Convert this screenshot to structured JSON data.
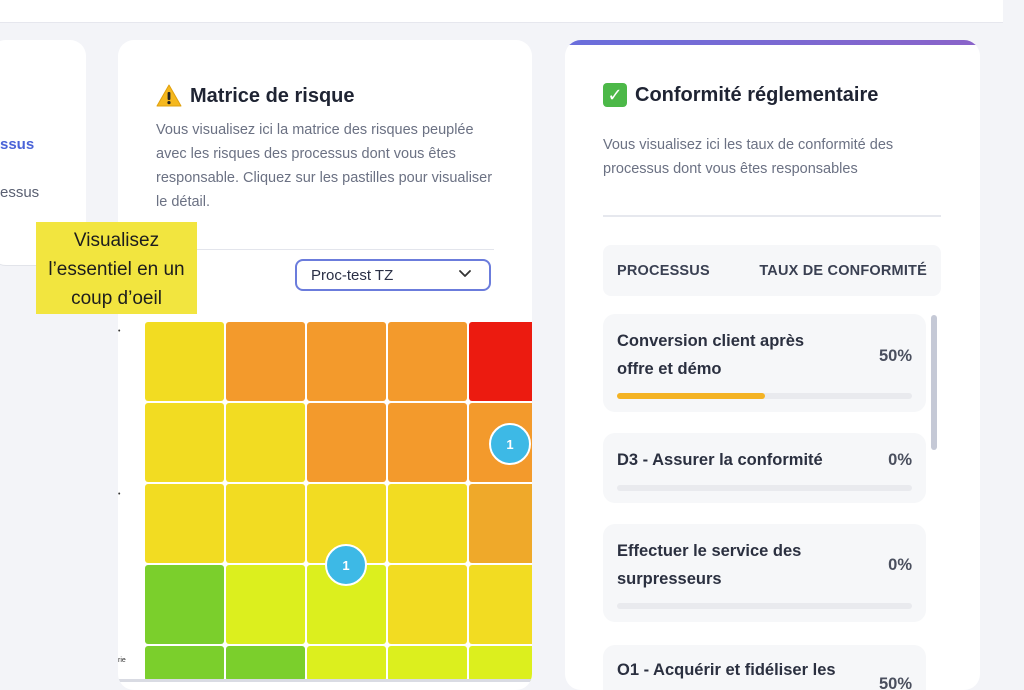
{
  "left_panel": {
    "item_active": "ssus",
    "item": "essus"
  },
  "matrix_card": {
    "title": "Matrice de risque",
    "description": "Vous visualisez ici la matrice des risques peuplée avec les risques des processus dont vous êtes responsable. Cliquez sur les pastilles pour visualiser le détail.",
    "select_value": "Proc-test TZ",
    "dot_labels": [
      "1",
      "1"
    ],
    "bottom_tick": "rie",
    "colors": {
      "red": "#ec1b10",
      "orange": "#f39a2c",
      "yellow_orange": "#efa92a",
      "yellow": "#f2dc22",
      "lime": "#dcef1e",
      "green": "#7bcf2c"
    }
  },
  "callout": {
    "text": "Visualisez l’essentiel en un coup d’oeil"
  },
  "conformity_card": {
    "title": "Conformité réglementaire",
    "description": "Vous visualisez ici les taux de conformité des processus dont vous êtes responsables",
    "table_headers": {
      "process": "PROCESSUS",
      "rate": "TAUX DE CONFORMITÉ"
    },
    "rows": [
      {
        "name_line1": "Conversion client après",
        "name_line2": "offre et démo",
        "percent": "50%",
        "progress": 0.5
      },
      {
        "name_line1": "D3 - Assurer la conformité",
        "name_line2": "",
        "percent": "0%",
        "progress": 0
      },
      {
        "name_line1": "Effectuer le service des",
        "name_line2": "surpresseurs",
        "percent": "0%",
        "progress": 0
      },
      {
        "name_line1": "O1 - Acquérir et fidéliser les",
        "name_line2": "",
        "percent": "50%",
        "progress": 0.5
      }
    ],
    "accent": "#f4b324"
  }
}
